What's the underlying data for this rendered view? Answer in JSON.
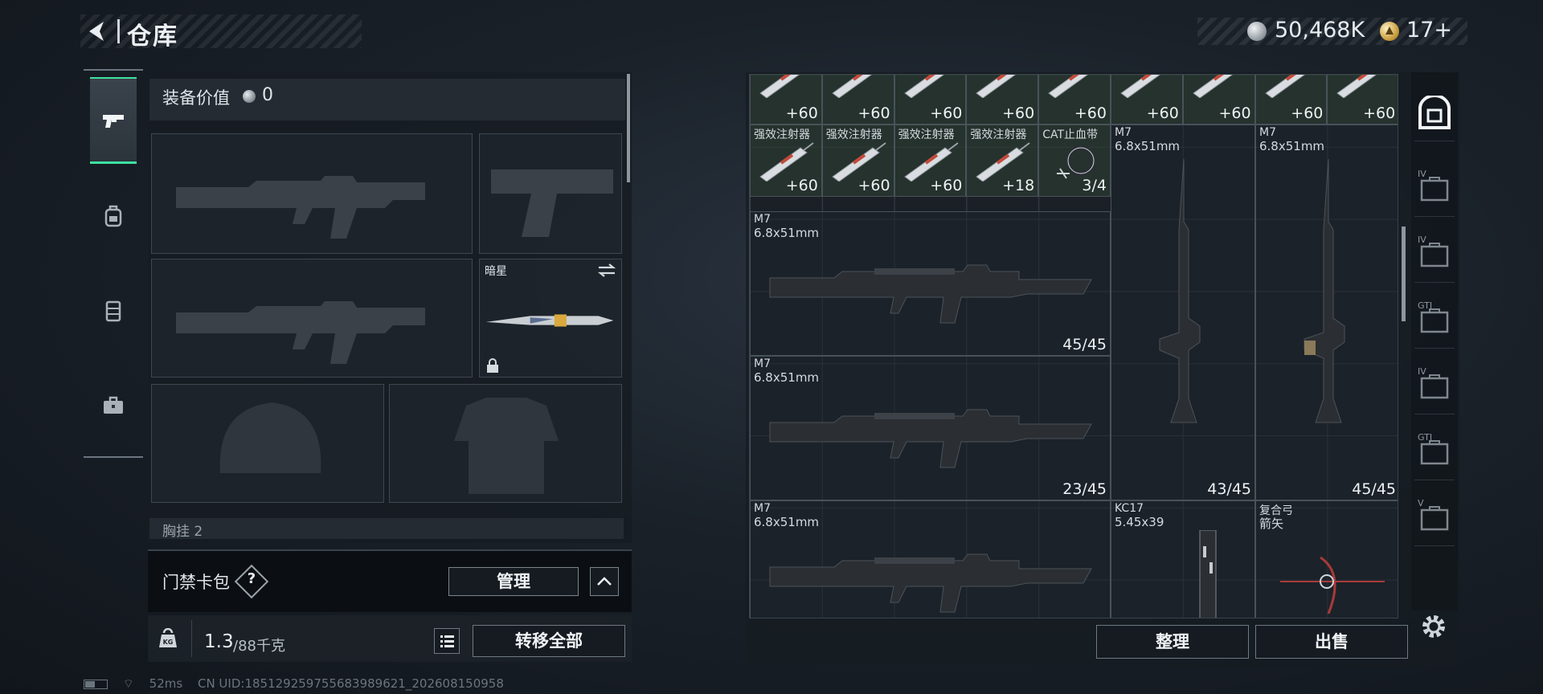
{
  "header": {
    "title": "仓库",
    "silver_amount": "50,468K",
    "gold_amount": "17+"
  },
  "categories": [
    {
      "name": "weapons",
      "icon": "pistol-icon",
      "active": true
    },
    {
      "name": "backpack",
      "icon": "backpack-icon",
      "active": false
    },
    {
      "name": "vest",
      "icon": "vest-icon",
      "active": false
    },
    {
      "name": "toolbox",
      "icon": "toolbox-icon",
      "active": false
    }
  ],
  "loadout": {
    "equip_value_label": "装备价值",
    "equip_value": "0",
    "melee_slot_label": "暗星",
    "next_section_label": "胸挂 2"
  },
  "card_bag": {
    "label": "门禁卡包",
    "help": "?",
    "manage_label": "管理"
  },
  "weight": {
    "current": "1.3",
    "max": "/88千克"
  },
  "transfer_all_label": "转移全部",
  "status": {
    "ping": "52ms",
    "uid": "CN UID:1851292597556839​89621_202608150958"
  },
  "inventory": {
    "row1_counts": [
      "+60",
      "+60",
      "+60",
      "+60",
      "+60",
      "+60",
      "+60",
      "+60",
      "+60"
    ],
    "row1_name": "强效注射器",
    "row2": [
      {
        "name": "强效注射器",
        "count": "+60"
      },
      {
        "name": "强效注射器",
        "count": "+60"
      },
      {
        "name": "强效注射器",
        "count": "+60"
      },
      {
        "name": "强效注射器",
        "count": "+18"
      },
      {
        "name": "CAT止血带",
        "count": "3/4"
      }
    ],
    "rifles": [
      {
        "name": "M7",
        "caliber": "6.8x51mm",
        "ammo": "45/45"
      },
      {
        "name": "M7",
        "caliber": "6.8x51mm",
        "ammo": "23/45"
      },
      {
        "name": "M7",
        "caliber": "6.8x51mm",
        "ammo": ""
      },
      {
        "name": "M7",
        "caliber": "6.8x51mm",
        "ammo": "43/45"
      },
      {
        "name": "M7",
        "caliber": "6.8x51mm",
        "ammo": "45/45"
      },
      {
        "name": "KC17",
        "caliber": "5.45x39",
        "ammo": ""
      },
      {
        "name": "复合弓",
        "caliber": "箭矢",
        "ammo": ""
      }
    ],
    "sort_label": "整理",
    "sell_label": "出售"
  },
  "stash_tabs": [
    "IV",
    "IV",
    "GTI",
    "IV",
    "GTI",
    "V"
  ],
  "colors": {
    "accent": "#3fe0a0",
    "background": "#1a2129",
    "panel": "#161c22"
  }
}
